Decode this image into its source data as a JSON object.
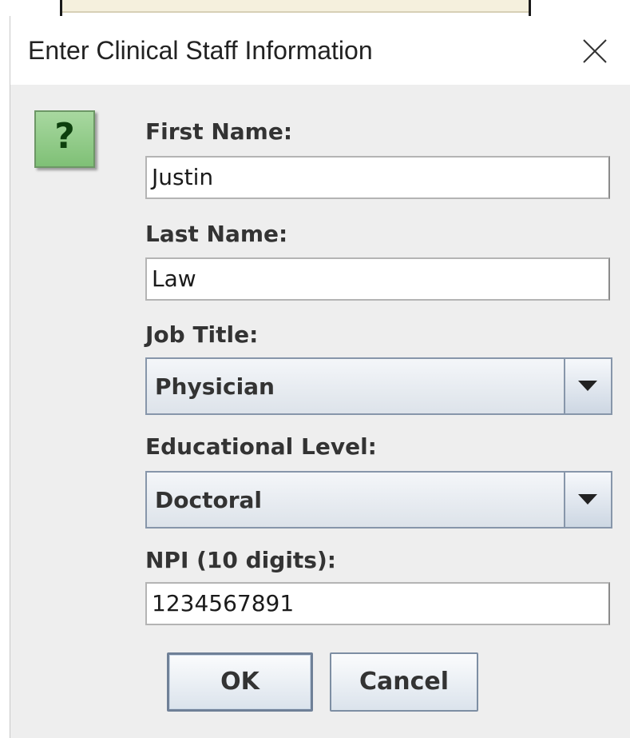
{
  "dialog": {
    "title": "Enter Clinical Staff Information",
    "close_icon": "close-icon",
    "icon": {
      "name": "question-icon",
      "glyph": "?"
    }
  },
  "form": {
    "first_name": {
      "label": "First Name:",
      "value": "Justin"
    },
    "last_name": {
      "label": "Last Name:",
      "value": "Law"
    },
    "job_title": {
      "label": "Job Title:",
      "selected": "Physician"
    },
    "educational_level": {
      "label": "Educational Level:",
      "selected": "Doctoral"
    },
    "npi": {
      "label": "NPI (10 digits):",
      "value": "1234567891"
    }
  },
  "buttons": {
    "ok_label": "OK",
    "cancel_label": "Cancel"
  },
  "colors": {
    "dialog_bg": "#eeeeee",
    "icon_green": "#8fcb85",
    "button_border": "#7d8ea3"
  }
}
